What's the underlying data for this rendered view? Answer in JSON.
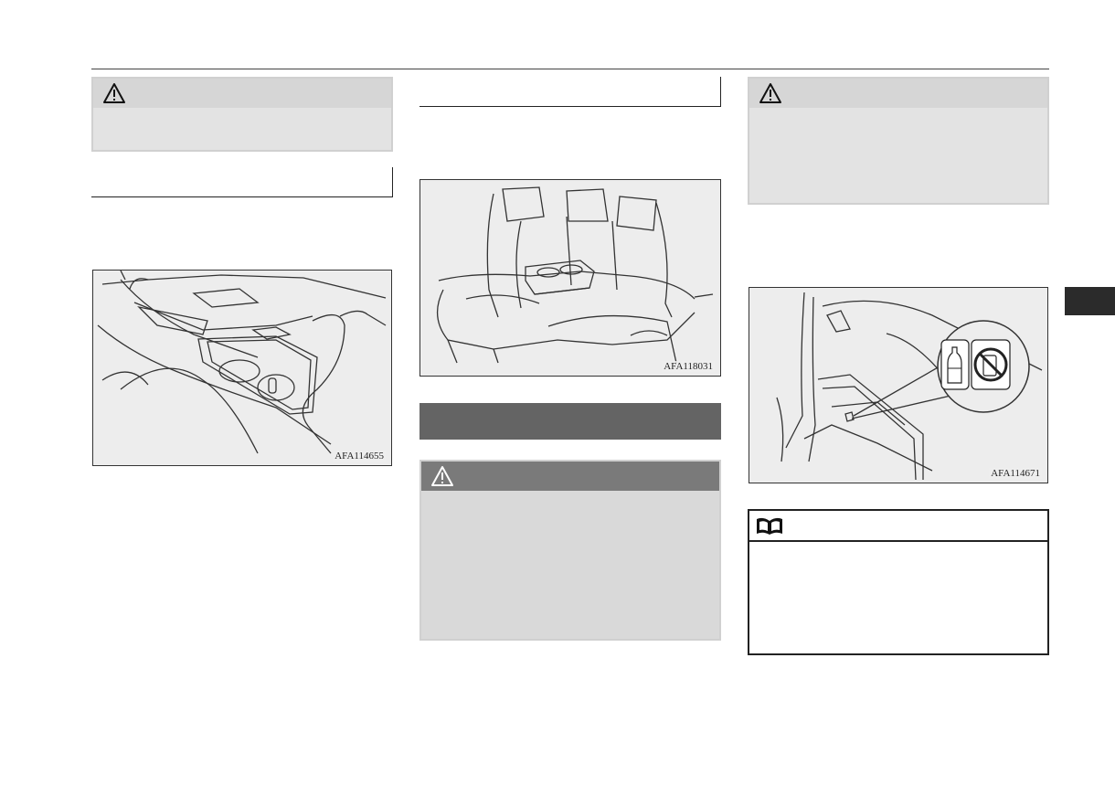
{
  "figures": {
    "console_cupholder": {
      "code": "AFA114655"
    },
    "rear_armrest": {
      "code": "AFA118031"
    },
    "door_pocket": {
      "code": "AFA114671"
    }
  },
  "icons": {
    "warning": "warning-triangle-icon",
    "note": "open-book-icon",
    "bottle": "bottle-icon",
    "no_can": "prohibited-can-icon"
  },
  "colors": {
    "warning_header_light": "#d6d6d6",
    "warning_header_dark": "#7a7a7a",
    "warning_body": "#e3e3e3",
    "section_bar": "#646464",
    "side_tab": "#2b2b2b"
  }
}
